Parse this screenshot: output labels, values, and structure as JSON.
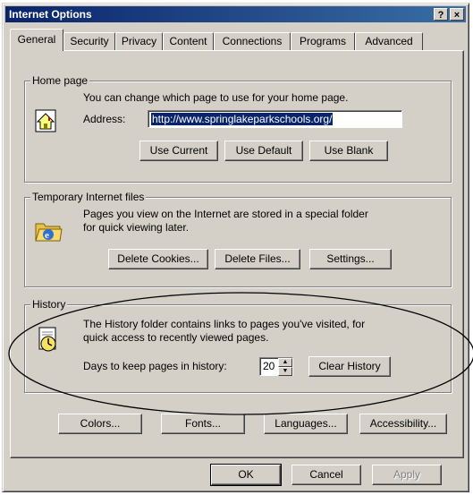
{
  "window": {
    "title": "Internet Options",
    "help_label": "?",
    "close_label": "×"
  },
  "tabs": [
    {
      "label": "General"
    },
    {
      "label": "Security"
    },
    {
      "label": "Privacy"
    },
    {
      "label": "Content"
    },
    {
      "label": "Connections"
    },
    {
      "label": "Programs"
    },
    {
      "label": "Advanced"
    }
  ],
  "home_page": {
    "group_label": "Home page",
    "description": "You can change which page to use for your home page.",
    "address_label": "Address:",
    "address_value": "http://www.springlakeparkschools.org/",
    "use_current": "Use Current",
    "use_default": "Use Default",
    "use_blank": "Use Blank"
  },
  "temp_files": {
    "group_label": "Temporary Internet files",
    "description_line1": "Pages you view on the Internet are stored in a special folder",
    "description_line2": "for quick viewing later.",
    "delete_cookies": "Delete Cookies...",
    "delete_files": "Delete Files...",
    "settings": "Settings..."
  },
  "history": {
    "group_label": "History",
    "description_line1": "The History folder contains links to pages you've visited, for",
    "description_line2": "quick access to recently viewed pages.",
    "days_label": "Days to keep pages in history:",
    "days_value": "20",
    "clear_history": "Clear History"
  },
  "bottom_buttons": {
    "colors": "Colors...",
    "fonts": "Fonts...",
    "languages": "Languages...",
    "accessibility": "Accessibility..."
  },
  "dialog_buttons": {
    "ok": "OK",
    "cancel": "Cancel",
    "apply": "Apply"
  },
  "colors": {
    "title_bar": "#0a246a",
    "face": "#d4d0c8",
    "selection": "#0a246a",
    "annotation_oval": "#000000"
  }
}
